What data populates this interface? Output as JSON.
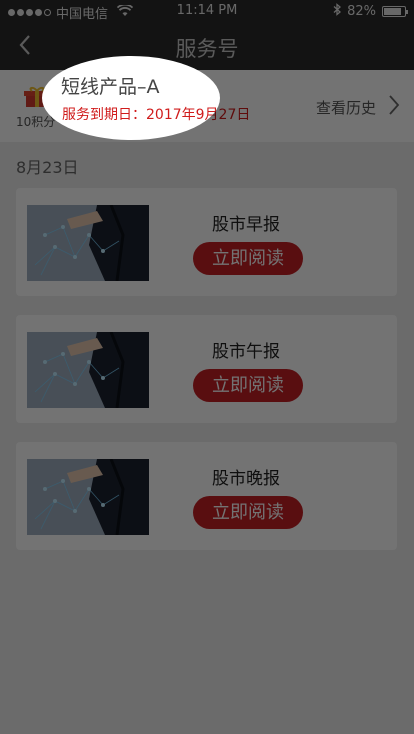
{
  "status_bar": {
    "carrier": "中国电信",
    "time": "11:14 PM",
    "battery": "82%",
    "battery_level": 0.82,
    "signal_bars": 4
  },
  "nav": {
    "title": "服务号",
    "back_icon": "back-arrow-icon"
  },
  "header": {
    "points": "10积分",
    "product_name": "短线产品–A",
    "expiry": "服务到期日：2017年9月27日",
    "history_label": "查看历史"
  },
  "date_label": "8月23日",
  "cards": [
    {
      "title": "股市早报",
      "button": "立即阅读"
    },
    {
      "title": "股市午报",
      "button": "立即阅读"
    },
    {
      "title": "股市晚报",
      "button": "立即阅读"
    }
  ],
  "colors": {
    "accent": "#c51f24",
    "expiry_text": "#d01c1c",
    "bar_bg": "#2b2b2b"
  }
}
